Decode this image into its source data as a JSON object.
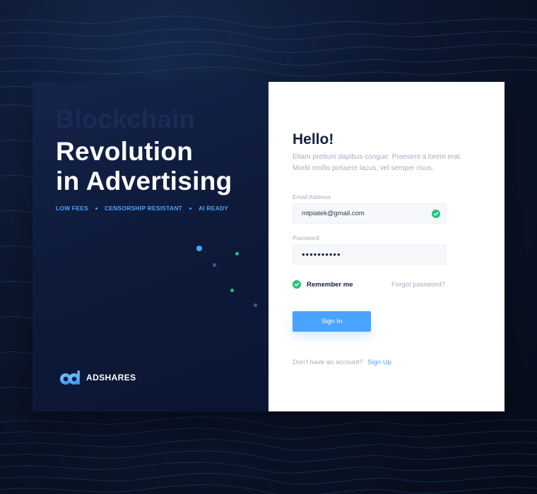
{
  "hero": {
    "ghost_word": "Blockchain",
    "headline_line1": "Revolution",
    "headline_line2": "in Advertising",
    "features": [
      "LOW FEES",
      "CENSORSHIP RESISTANT",
      "AI READY"
    ]
  },
  "brand": {
    "name": "ADSHARES",
    "logo_icon": "adshares-logo-icon"
  },
  "login": {
    "title": "Hello!",
    "intro": "Etiam pretium dapibus congue. Praesent a lorem erat. Morbi mollis posuere lacus, vel semper risus.",
    "email_label": "Email Address",
    "email_value": "mtpiatek@gmail.com",
    "email_valid_icon": "check-circle-icon",
    "password_label": "Password",
    "password_value": "••••••••••",
    "remember_label": "Remember me",
    "remember_checked": true,
    "forgot_label": "Forgot password?",
    "signin_label": "Sign In",
    "signup_question": "Don't have an account?",
    "signup_link": "Sign Up"
  },
  "colors": {
    "accent": "#4aa3ff",
    "success": "#24c27b",
    "dark_panel": "#0d1a3a",
    "title_text": "#15213f",
    "muted_text": "#a6adc2"
  }
}
